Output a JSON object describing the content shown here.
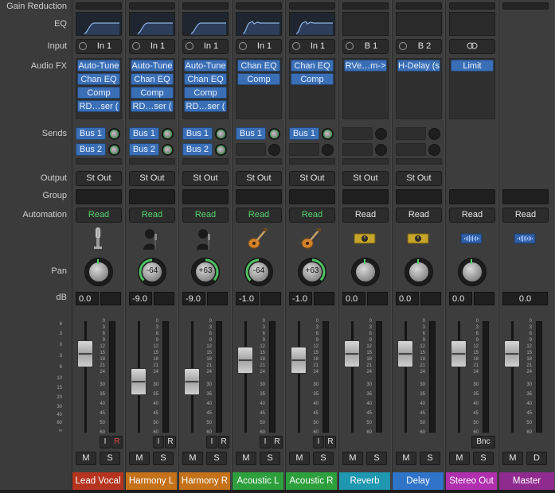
{
  "row_labels": {
    "gain_reduction": "Gain Reduction",
    "eq": "EQ",
    "input": "Input",
    "audio_fx": "Audio FX",
    "sends": "Sends",
    "output": "Output",
    "group": "Group",
    "automation": "Automation",
    "pan": "Pan",
    "db": "dB"
  },
  "meter_scale": [
    "0",
    "3",
    "6",
    "9",
    "12",
    "15",
    "18",
    "21",
    "24",
    "30",
    "35",
    "40",
    "45",
    "50",
    "60"
  ],
  "fader_scale": [
    "6",
    "3",
    "0",
    "3",
    "6",
    "10",
    "15",
    "20",
    "30",
    "40",
    "60",
    "∞"
  ],
  "colors": {
    "lead_vocal": "#b5341f",
    "harmony": "#c4711a",
    "acoustic": "#2e9f3d",
    "reverb": "#1f97b0",
    "delay": "#2f74c8",
    "stereo_out": "#b02fae",
    "master": "#8f2b8e",
    "automation_read_green": "#55d46e",
    "plugin_slot_blue": "#3a6fb6"
  },
  "strips": [
    {
      "name": "Lead Vocal",
      "eq": "curve",
      "input": "In 1",
      "input_type": "mono",
      "fx": [
        "Auto-Tune",
        "Chan EQ",
        "Comp",
        "RD…ser ("
      ],
      "sends": [
        "Bus 1",
        "Bus 2"
      ],
      "output": "St Out",
      "automation": "Read",
      "automation_color": "green",
      "icon": "microphone-icon",
      "pan": "",
      "pan_level": 0,
      "db_volume": "0.0",
      "db_peak": "",
      "fader_level": 0.81,
      "ir": [
        "I",
        "R"
      ],
      "ir_red": true,
      "mute": "M",
      "solo": "S",
      "color_key": "lead_vocal"
    },
    {
      "name": "Harmony L",
      "eq": "curve",
      "input": "In 1",
      "input_type": "mono",
      "fx": [
        "Auto-Tune",
        "Chan EQ",
        "Comp",
        "RD…ser ("
      ],
      "sends": [
        "Bus 1",
        "Bus 2"
      ],
      "output": "St Out",
      "automation": "Read",
      "automation_color": "green",
      "icon": "vocalist-icon",
      "pan": "-64",
      "pan_level": -64,
      "db_volume": "-9.0",
      "db_peak": "",
      "fader_level": 0.48,
      "ir": [
        "I",
        "R"
      ],
      "ir_red": false,
      "mute": "M",
      "solo": "S",
      "color_key": "harmony"
    },
    {
      "name": "Harmony R",
      "eq": "curve",
      "input": "In 1",
      "input_type": "mono",
      "fx": [
        "Auto-Tune",
        "Chan EQ",
        "Comp",
        "RD…ser ("
      ],
      "sends": [
        "Bus 1",
        "Bus 2"
      ],
      "output": "St Out",
      "automation": "Read",
      "automation_color": "green",
      "icon": "vocalist-icon",
      "pan": "+63",
      "pan_level": 63,
      "db_volume": "-9.0",
      "db_peak": "",
      "fader_level": 0.48,
      "ir": [
        "I",
        "R"
      ],
      "ir_red": false,
      "mute": "M",
      "solo": "S",
      "color_key": "harmony"
    },
    {
      "name": "Acoustic L",
      "eq": "curve2",
      "input": "In 1",
      "input_type": "mono",
      "fx": [
        "Chan EQ",
        "Comp"
      ],
      "sends": [
        "Bus 1"
      ],
      "output": "St Out",
      "automation": "Read",
      "automation_color": "green",
      "icon": "acoustic-guitar-icon",
      "pan": "-64",
      "pan_level": -64,
      "db_volume": "-1.0",
      "db_peak": "",
      "fader_level": 0.74,
      "ir": [
        "I",
        "R"
      ],
      "ir_red": false,
      "mute": "M",
      "solo": "S",
      "color_key": "acoustic"
    },
    {
      "name": "Acoustic R",
      "eq": "curve2",
      "input": "In 1",
      "input_type": "mono",
      "fx": [
        "Chan EQ",
        "Comp"
      ],
      "sends": [
        "Bus 1"
      ],
      "output": "St Out",
      "automation": "Read",
      "automation_color": "green",
      "icon": "acoustic-guitar-icon",
      "pan": "+63",
      "pan_level": 63,
      "db_volume": "-1.0",
      "db_peak": "",
      "fader_level": 0.74,
      "ir": [
        "I",
        "R"
      ],
      "ir_red": false,
      "mute": "M",
      "solo": "S",
      "color_key": "acoustic"
    },
    {
      "name": "Reverb",
      "eq": "empty",
      "input": "B 1",
      "input_type": "mono",
      "fx": [
        "RVe…m->"
      ],
      "sends": [],
      "output": "St Out",
      "automation": "Read",
      "automation_color": "white",
      "icon": "aux-icon",
      "pan": "",
      "pan_level": 0,
      "db_volume": "0.0",
      "db_peak": "",
      "fader_level": 0.81,
      "ir": [],
      "ir_red": false,
      "mute": "M",
      "solo": "S",
      "color_key": "reverb"
    },
    {
      "name": "Delay",
      "eq": "empty",
      "input": "B 2",
      "input_type": "mono",
      "fx": [
        "H-Delay (s"
      ],
      "sends": [],
      "output": "St Out",
      "automation": "Read",
      "automation_color": "white",
      "icon": "aux-icon",
      "pan": "",
      "pan_level": 0,
      "db_volume": "0.0",
      "db_peak": "",
      "fader_level": 0.81,
      "ir": [],
      "ir_red": false,
      "mute": "M",
      "solo": "S",
      "color_key": "delay"
    },
    {
      "name": "Stereo Out",
      "eq": "empty",
      "input": "",
      "input_type": "link",
      "fx": [
        "Limit"
      ],
      "sends": [],
      "output": "",
      "automation": "Read",
      "automation_color": "white",
      "icon": "waveform-icon",
      "pan": "",
      "pan_level": 0,
      "db_volume": "0.0",
      "db_peak": "",
      "fader_level": 0.81,
      "bnc": "Bnc",
      "ir": [],
      "ir_red": false,
      "mute": "M",
      "solo": "S",
      "color_key": "stereo_out"
    },
    {
      "name": "Master",
      "eq": "none",
      "input": "",
      "input_type": "none",
      "fx": [],
      "sends": [],
      "output": "",
      "automation": "Read",
      "automation_color": "white",
      "icon": "waveform-icon",
      "pan": "none",
      "pan_level": 0,
      "db_volume": "0.0",
      "db_peak": "",
      "fader_level": 0.81,
      "ir": [],
      "ir_red": false,
      "mute": "M",
      "solo": "D",
      "color_key": "master"
    }
  ]
}
